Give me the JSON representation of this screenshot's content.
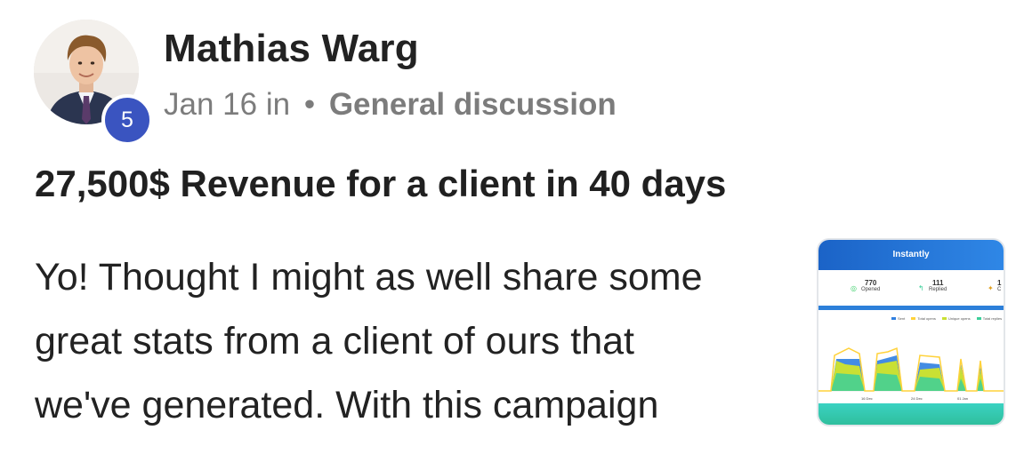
{
  "post": {
    "author": {
      "name": "Mathias Warg",
      "level": "5"
    },
    "date": "Jan 16",
    "in_text": "in",
    "separator": "•",
    "category": "General discussion",
    "title": "27,500$ Revenue for a client in 40 days",
    "body_lines": [
      "Yo! Thought I might as well share some",
      "great stats from a client of ours that",
      "we've generated. With this campaign"
    ]
  },
  "thumbnail": {
    "brand": "Instantly",
    "stats": [
      {
        "value": "770",
        "label": "Opened"
      },
      {
        "value": "111",
        "label": "Replied"
      },
      {
        "value": "1",
        "label": "C"
      }
    ],
    "legend": [
      "Sent",
      "Total opens",
      "Unique opens",
      "Total replies"
    ],
    "axis_labels": [
      "16 Dec",
      "24 Dec",
      "01 Jan"
    ],
    "colors": {
      "header": "#1b63c7",
      "sent": "#2f7fe0",
      "opens": "#c9e034",
      "unique": "#3ccf9a",
      "replies": "#ffd23a",
      "footer": "#3bd2c2"
    }
  },
  "colors": {
    "badge": "#3a54c0",
    "meta": "#7c7c7c",
    "text": "#222222"
  }
}
